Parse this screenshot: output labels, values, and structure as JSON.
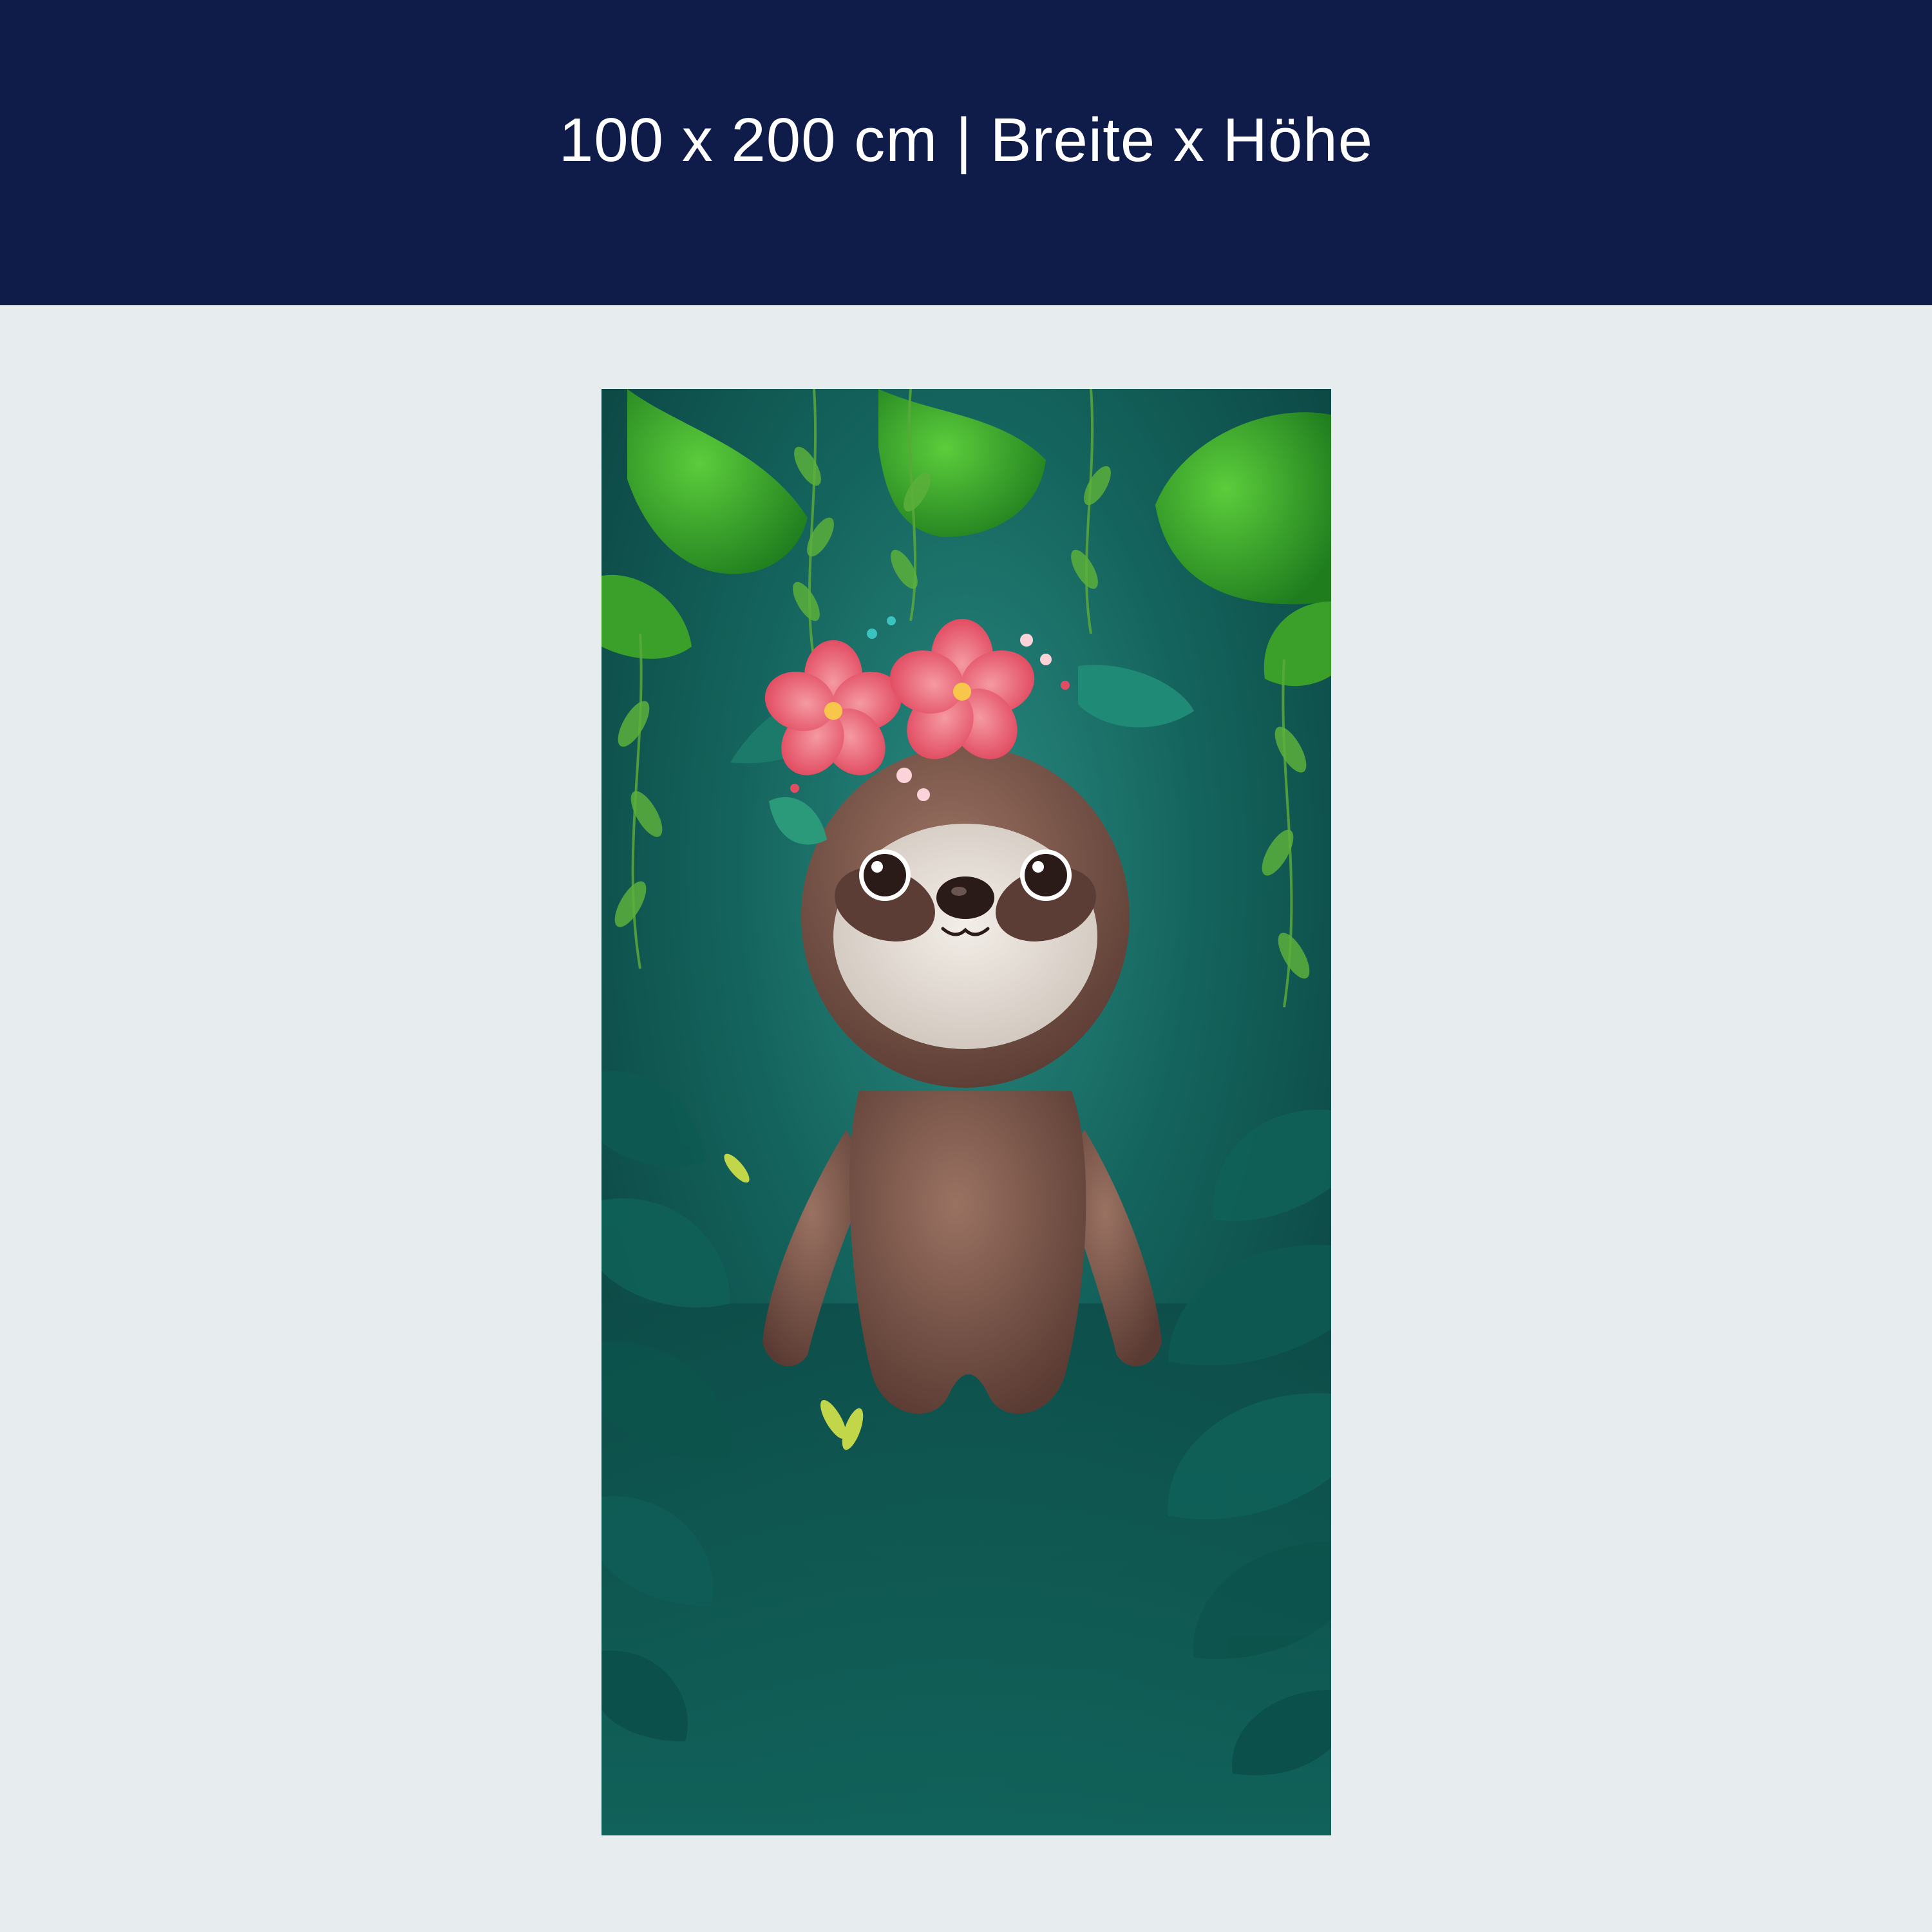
{
  "banner": {
    "title": "100 x 200 cm | Breite x Höhe",
    "background_color": "#0f1c4a",
    "text_color": "#ffffff"
  },
  "page": {
    "background_color": "#e7ecee"
  },
  "poster": {
    "image_subject": "baby sloth with hibiscus flower crown in jungle",
    "colors": {
      "background_teal": "#0f5a55",
      "leaf_green": "#3fae2e",
      "fur_brown": "#7a5546",
      "face_cream": "#e9e2da",
      "hibiscus_pink": "#f0677a"
    }
  }
}
